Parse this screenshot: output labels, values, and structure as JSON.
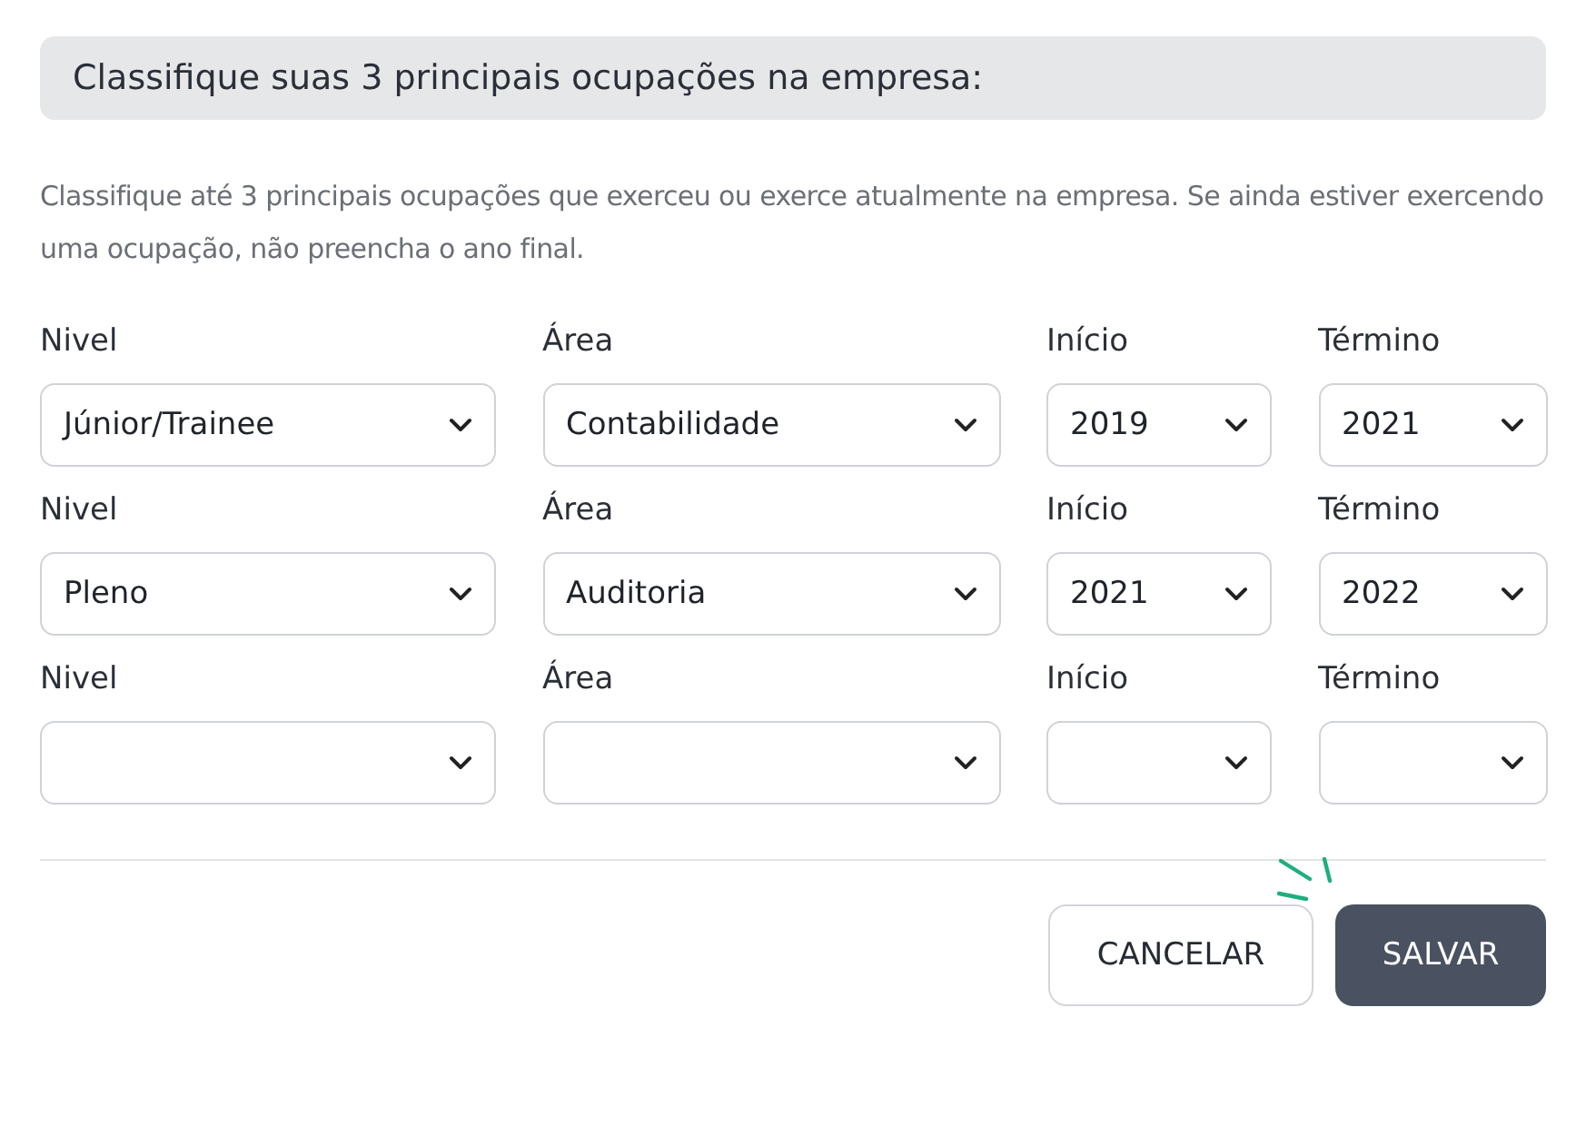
{
  "header": {
    "title": "Classifique suas 3 principais ocupações na empresa:"
  },
  "description": "Classifique até 3 principais ocupações que exerceu ou exerce atualmente na empresa. Se ainda estiver exercendo uma ocupação, não preencha o ano final.",
  "rows": [
    {
      "fields": [
        {
          "label": "Nivel",
          "value": "Júnior/Trainee"
        },
        {
          "label": "Área",
          "value": "Contabilidade"
        },
        {
          "label": "Início",
          "value": "2019"
        },
        {
          "label": "Término",
          "value": "2021"
        }
      ]
    },
    {
      "fields": [
        {
          "label": "Nivel",
          "value": "Pleno"
        },
        {
          "label": "Área",
          "value": "Auditoria"
        },
        {
          "label": "Início",
          "value": "2021"
        },
        {
          "label": "Término",
          "value": "2022"
        }
      ]
    },
    {
      "fields": [
        {
          "label": "Nivel"
        },
        {
          "label": "Área"
        },
        {
          "label": "Início"
        },
        {
          "label": "Término"
        }
      ]
    }
  ],
  "buttons": [
    {
      "label": "CANCELAR",
      "kind": "secondary"
    },
    {
      "label": "SALVAR",
      "kind": "primary"
    }
  ]
}
